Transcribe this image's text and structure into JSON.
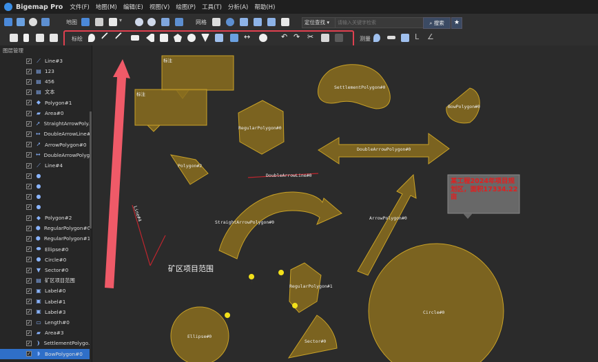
{
  "app": {
    "title": "Bigemap Pro"
  },
  "menu": [
    "文件(F)",
    "地图(M)",
    "编辑(E)",
    "视图(V)",
    "绘图(P)",
    "工具(T)",
    "分析(A)",
    "帮助(H)"
  ],
  "toolbar1": {
    "map_label": "地图",
    "grid_label": "网格",
    "locate_select": "定位查找",
    "search_placeholder": "请输入关键字检索",
    "search_button": "搜索"
  },
  "toolbar2": {
    "draw_label": "标绘",
    "measure_label": "测量"
  },
  "sidebar": {
    "title": "图层管理",
    "layers": [
      {
        "label": "Line#3",
        "icon": "line-icon"
      },
      {
        "label": "123",
        "icon": "text-icon"
      },
      {
        "label": "456",
        "icon": "text-icon"
      },
      {
        "label": "文本",
        "icon": "text-icon"
      },
      {
        "label": "Polygon#1",
        "icon": "polygon-icon"
      },
      {
        "label": "Area#0",
        "icon": "area-icon"
      },
      {
        "label": "StraightArrowPoly...",
        "icon": "arrow-icon"
      },
      {
        "label": "DoubleArrowLine#0",
        "icon": "double-arrow-icon"
      },
      {
        "label": "ArrowPolygon#0",
        "icon": "arrow-icon"
      },
      {
        "label": "DoubleArrowPolyg...",
        "icon": "double-arrow-icon"
      },
      {
        "label": "Line#4",
        "icon": "line-icon"
      },
      {
        "label": "",
        "icon": "marker-icon"
      },
      {
        "label": "",
        "icon": "marker-icon"
      },
      {
        "label": "",
        "icon": "marker-icon"
      },
      {
        "label": "",
        "icon": "marker-icon"
      },
      {
        "label": "Polygon#2",
        "icon": "polygon-icon"
      },
      {
        "label": "RegularPolygon#0",
        "icon": "hexagon-icon"
      },
      {
        "label": "RegularPolygon#1",
        "icon": "hexagon-icon"
      },
      {
        "label": "Ellipse#0",
        "icon": "ellipse-icon"
      },
      {
        "label": "Circle#0",
        "icon": "circle-icon"
      },
      {
        "label": "Sector#0",
        "icon": "sector-icon"
      },
      {
        "label": "矿区项目范围",
        "icon": "text-icon"
      },
      {
        "label": "Label#0",
        "icon": "label-icon"
      },
      {
        "label": "Label#1",
        "icon": "label-icon"
      },
      {
        "label": "Label#3",
        "icon": "label-icon"
      },
      {
        "label": "Length#0",
        "icon": "ruler-icon"
      },
      {
        "label": "Area#3",
        "icon": "area-icon"
      },
      {
        "label": "SettlementPolygo...",
        "icon": "settlement-icon"
      },
      {
        "label": "BowPolygon#0",
        "icon": "bow-icon"
      }
    ],
    "selected_index": 28
  },
  "canvas": {
    "label_box_1": "标注",
    "label_box_2": "标注",
    "settlement": "SettlementPolygon#0",
    "bow": "BowPolygon#0",
    "regular0": "RegularPolygon#0",
    "double_arrow_polygon": "DoubleArrowPolygon#0",
    "polygon2": "Polygon#2",
    "double_arrow_line": "DoubleArrowLine#0",
    "straight_arrow": "StraightArrowPolygon#0",
    "arrow_polygon": "ArrowPolygon#0",
    "line4": "Line#4",
    "mine_text": "矿区项目范围",
    "regular1": "RegularPolygon#1",
    "circle": "Circle#0",
    "ellipse": "Ellipse#0",
    "sector": "Sector#0",
    "callout": "某工程2024年项目规划区，面积17334.22亩"
  },
  "colors": {
    "shape_fill": "#8a6d1e",
    "shape_stroke": "#c9a227",
    "highlight": "#e0404f",
    "callout_text": "#e02020",
    "selected_row": "#2f6fc8"
  }
}
